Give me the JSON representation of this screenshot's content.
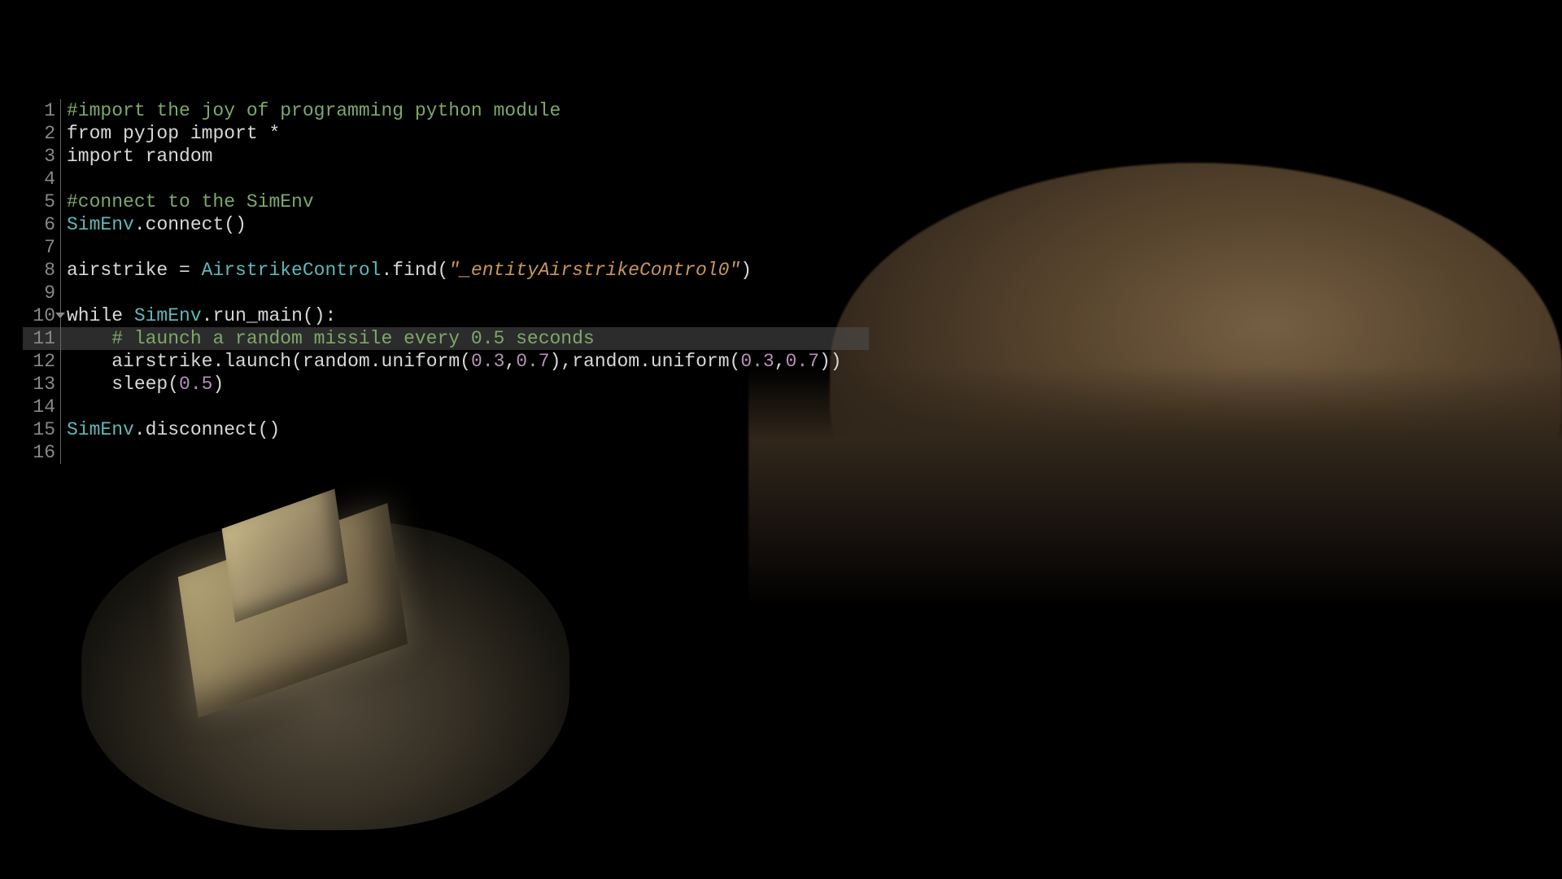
{
  "editor": {
    "highlighted_line": 11,
    "fold_line": 10,
    "lines": [
      {
        "num": "1",
        "tokens": [
          {
            "cls": "tok-comment",
            "text": "#import the joy of programming python module"
          }
        ]
      },
      {
        "num": "2",
        "tokens": [
          {
            "cls": "tok-keyword",
            "text": "from"
          },
          {
            "cls": "tok-ident",
            "text": " pyjop "
          },
          {
            "cls": "tok-keyword",
            "text": "import"
          },
          {
            "cls": "tok-ident",
            "text": " *"
          }
        ]
      },
      {
        "num": "3",
        "tokens": [
          {
            "cls": "tok-keyword",
            "text": "import"
          },
          {
            "cls": "tok-ident",
            "text": " random"
          }
        ]
      },
      {
        "num": "4",
        "tokens": []
      },
      {
        "num": "5",
        "tokens": [
          {
            "cls": "tok-comment",
            "text": "#connect to the SimEnv"
          }
        ]
      },
      {
        "num": "6",
        "tokens": [
          {
            "cls": "tok-class",
            "text": "SimEnv"
          },
          {
            "cls": "tok-punct",
            "text": "."
          },
          {
            "cls": "tok-func",
            "text": "connect"
          },
          {
            "cls": "tok-punct",
            "text": "()"
          }
        ]
      },
      {
        "num": "7",
        "tokens": []
      },
      {
        "num": "8",
        "tokens": [
          {
            "cls": "tok-ident",
            "text": "airstrike "
          },
          {
            "cls": "tok-punct",
            "text": "= "
          },
          {
            "cls": "tok-class",
            "text": "AirstrikeControl"
          },
          {
            "cls": "tok-punct",
            "text": "."
          },
          {
            "cls": "tok-func",
            "text": "find"
          },
          {
            "cls": "tok-punct",
            "text": "("
          },
          {
            "cls": "tok-string",
            "text": "\"_entityAirstrikeControl0\""
          },
          {
            "cls": "tok-punct",
            "text": ")"
          }
        ]
      },
      {
        "num": "9",
        "tokens": []
      },
      {
        "num": "10",
        "tokens": [
          {
            "cls": "tok-keyword",
            "text": "while"
          },
          {
            "cls": "tok-ident",
            "text": " "
          },
          {
            "cls": "tok-class",
            "text": "SimEnv"
          },
          {
            "cls": "tok-punct",
            "text": "."
          },
          {
            "cls": "tok-func",
            "text": "run_main"
          },
          {
            "cls": "tok-punct",
            "text": "():"
          }
        ]
      },
      {
        "num": "11",
        "tokens": [
          {
            "cls": "tok-ident",
            "text": "    "
          },
          {
            "cls": "tok-comment",
            "text": "# launch a random missile every 0.5 seconds"
          }
        ]
      },
      {
        "num": "12",
        "tokens": [
          {
            "cls": "tok-ident",
            "text": "    airstrike"
          },
          {
            "cls": "tok-punct",
            "text": "."
          },
          {
            "cls": "tok-func",
            "text": "launch"
          },
          {
            "cls": "tok-punct",
            "text": "("
          },
          {
            "cls": "tok-ident",
            "text": "random"
          },
          {
            "cls": "tok-punct",
            "text": "."
          },
          {
            "cls": "tok-func",
            "text": "uniform"
          },
          {
            "cls": "tok-punct",
            "text": "("
          },
          {
            "cls": "tok-num",
            "text": "0.3"
          },
          {
            "cls": "tok-punct",
            "text": ","
          },
          {
            "cls": "tok-num",
            "text": "0.7"
          },
          {
            "cls": "tok-punct",
            "text": "),"
          },
          {
            "cls": "tok-ident",
            "text": "random"
          },
          {
            "cls": "tok-punct",
            "text": "."
          },
          {
            "cls": "tok-func",
            "text": "uniform"
          },
          {
            "cls": "tok-punct",
            "text": "("
          },
          {
            "cls": "tok-num",
            "text": "0.3"
          },
          {
            "cls": "tok-punct",
            "text": ","
          },
          {
            "cls": "tok-num",
            "text": "0.7"
          },
          {
            "cls": "tok-punct",
            "text": "))"
          }
        ]
      },
      {
        "num": "13",
        "tokens": [
          {
            "cls": "tok-ident",
            "text": "    "
          },
          {
            "cls": "tok-func",
            "text": "sleep"
          },
          {
            "cls": "tok-punct",
            "text": "("
          },
          {
            "cls": "tok-num",
            "text": "0.5"
          },
          {
            "cls": "tok-punct",
            "text": ")"
          }
        ]
      },
      {
        "num": "14",
        "tokens": []
      },
      {
        "num": "15",
        "tokens": [
          {
            "cls": "tok-class",
            "text": "SimEnv"
          },
          {
            "cls": "tok-punct",
            "text": "."
          },
          {
            "cls": "tok-func",
            "text": "disconnect"
          },
          {
            "cls": "tok-punct",
            "text": "()"
          }
        ]
      },
      {
        "num": "16",
        "tokens": []
      }
    ]
  }
}
